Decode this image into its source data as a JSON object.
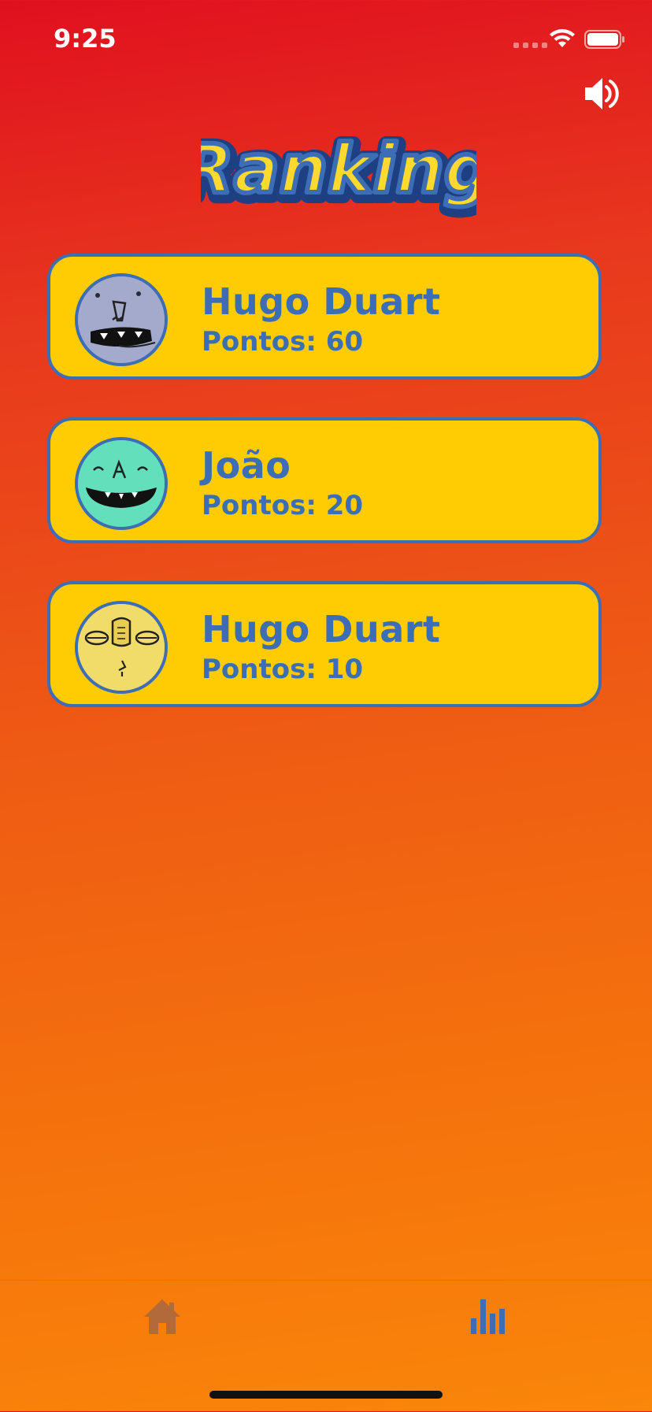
{
  "status_bar": {
    "time": "9:25"
  },
  "header": {
    "logo_text": "Ranking"
  },
  "ranking": [
    {
      "name": "Hugo Duart",
      "points_label": "Pontos: 60",
      "avatar": "gray-monster-avatar"
    },
    {
      "name": "João",
      "points_label": "Pontos: 20",
      "avatar": "green-monster-avatar"
    },
    {
      "name": "Hugo Duart",
      "points_label": "Pontos: 10",
      "avatar": "yellow-monster-avatar"
    }
  ],
  "tab_bar": {
    "items": [
      {
        "icon": "home-icon",
        "active": false
      },
      {
        "icon": "bar-chart-icon",
        "active": true
      }
    ]
  },
  "colors": {
    "card_fill": "#FFCC03",
    "card_text": "#3B6EB4",
    "tab_active": "#3D6DB5",
    "tab_inactive": "#B26A3A"
  }
}
